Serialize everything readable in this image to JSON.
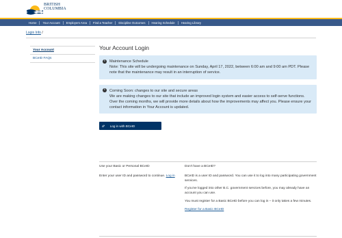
{
  "header": {
    "logo_line1": "BRITISH",
    "logo_line2": "COLUMBIA"
  },
  "nav": [
    {
      "label": "Home"
    },
    {
      "label": "Your Account"
    },
    {
      "label": "Employers Area"
    },
    {
      "label": "Find a Teacher"
    },
    {
      "label": "Discipline Outcomes"
    },
    {
      "label": "Hearing Schedule"
    },
    {
      "label": "Hearing Library"
    }
  ],
  "breadcrumb": {
    "link": "Login Info",
    "separator": "/"
  },
  "sidebar": {
    "items": [
      {
        "label": "Your Account"
      },
      {
        "label": "BCeID FAQs"
      }
    ]
  },
  "main": {
    "title": "Your Account Login",
    "alerts": [
      {
        "title": "Maintenance Schedule",
        "body": "Note: This site will be undergoing maintenance on Sunday, April 17, 2022, between 6:00 am and 9:00 am PDT. Please note that the maintenance may result in an interruption of service."
      },
      {
        "title": "Coming Soon: changes to our site and secure areas",
        "body": "We are making changes to our site that include an improved login system and easier access to self-serve functions. Over the coming months, we will provide more details about how the improvements may affect you. Please ensure your contact information in Your Account is updated."
      }
    ],
    "login_button": "Log in with BCeID"
  },
  "left_col": {
    "heading": "Use your Basic or Personal BCeID",
    "text_before": "Enter your user ID and password to continue.",
    "link": "Log in"
  },
  "right_col": {
    "heading": "Don't have a BCeID?",
    "p1": "BCeID is a user ID and password. You can use it to log into many participating government services.",
    "p2": "If you've logged into other B.C. government services before, you may already have an account you can use.",
    "p3": "You must register for a Basic BCeID before you can log in – it only takes a few minutes.",
    "link": "Register for a Basic BCeID"
  },
  "colors": {
    "nav_bg": "#38598a",
    "accent_gold": "#fcba19",
    "alert_bg": "#d9eaf7",
    "button_bg": "#003366",
    "link": "#1a5a96"
  }
}
